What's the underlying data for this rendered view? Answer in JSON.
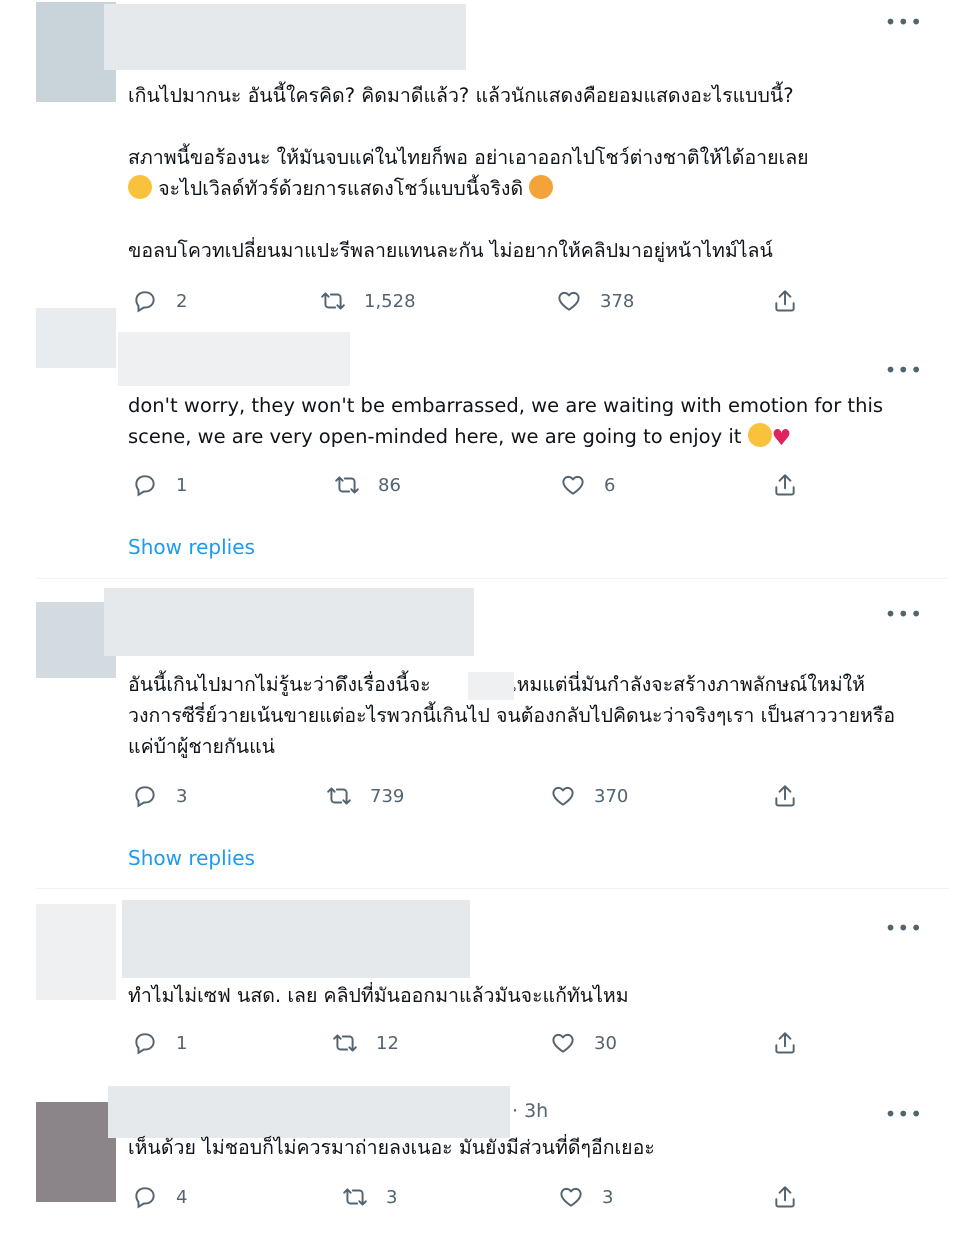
{
  "tweets": [
    {
      "text": "เกินไปมากนะ อันนี้ใครคิด? คิดมาดีแล้ว? แล้วนักแสดงคือยอมแสดงอะไรแบบนี้?\n\nสภาพนี้ขอร้องนะ ให้มันจบแค่ในไทยก็พอ อย่าเอาออกไปโชว์ต่างชาติให้ได้อายเลย",
      "text_line2": "จะไปเวิลด์ทัวร์ด้วยการแสดงโชว์แบบนี้จริงดิ",
      "text_tail": "ขอลบโควทเปลี่ยนมาแปะรีพลายแทนละกัน ไม่อยากให้คลิปมาอยู่หน้าไทม์ไลน์",
      "replies": "2",
      "retweets": "1,528",
      "likes": "378"
    },
    {
      "text": "don't worry, they won't be embarrassed, we are waiting with emotion for this scene, we are very open-minded here, we are going to enjoy it",
      "replies": "1",
      "retweets": "86",
      "likes": "6",
      "show_replies": "Show replies"
    },
    {
      "text": "อันนี้เกินไปมากไม่รู้นะว่าดึงเรื่องนี้จะ        ฉันไหมแต่นี่มันกำลังจะสร้างภาพลักษณ์ใหม่ให้วงการซีรี่ย์วายเน้นขายแต่อะไรพวกนี้เกินไป จนต้องกลับไปคิดนะว่าจริงๆเรา เป็นสาววายหรือแค่บ้าผู้ชายกันแน่",
      "replies": "3",
      "retweets": "739",
      "likes": "370",
      "show_replies": "Show replies"
    },
    {
      "text": "ทำไมไม่เซฟ นสด. เลย คลิปที่มันออกมาแล้วมันจะแก้ทันไหม",
      "replies": "1",
      "retweets": "12",
      "likes": "30"
    },
    {
      "time": "· 3h",
      "text": "เห็นด้วย ไม่ชอบก็ไม่ควรมาถ่ายลงเนอะ มันยังมีส่วนที่ดีๆอีกเยอะ",
      "replies": "4",
      "retweets": "3",
      "likes": "3"
    }
  ],
  "icons": {
    "more": "more-icon",
    "reply": "reply-icon",
    "retweet": "retweet-icon",
    "like": "like-icon",
    "share": "share-icon"
  },
  "colors": {
    "link": "#1d9bf0",
    "muted": "#536471",
    "text": "#0f1419"
  }
}
